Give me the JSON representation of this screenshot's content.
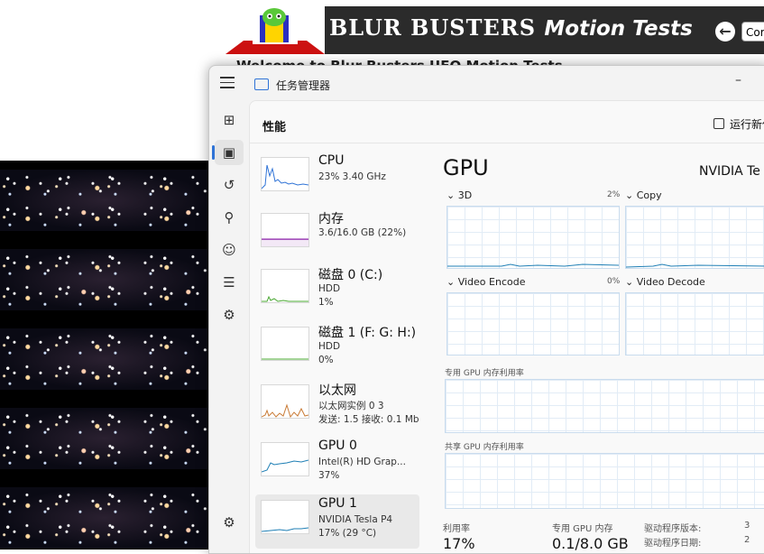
{
  "background_page": {
    "banner_title": "BLUR BUSTERS",
    "banner_subtitle": "Motion Tests",
    "back_icon": "arrow-left-icon",
    "continue_label": "Cor",
    "welcome_text": "Welcome to Blur Busters UFO Motion Tests"
  },
  "task_manager": {
    "window_title": "任务管理器",
    "section_title": "性能",
    "run_task_label": "运行新任",
    "minimize_glyph": "–",
    "nav": [
      {
        "icon": "processes-icon",
        "glyph": "⊞"
      },
      {
        "icon": "performance-icon",
        "glyph": "▣"
      },
      {
        "icon": "app-history-icon",
        "glyph": "↺"
      },
      {
        "icon": "startup-apps-icon",
        "glyph": "⚲"
      },
      {
        "icon": "users-icon",
        "glyph": "☺"
      },
      {
        "icon": "details-icon",
        "glyph": "☰"
      },
      {
        "icon": "services-icon",
        "glyph": "⚙"
      }
    ],
    "settings_glyph": "⚙",
    "devices": [
      {
        "name": "CPU",
        "line1": "23% 3.40 GHz",
        "line2": "",
        "graph_color": "#2f73d6",
        "usage": 0.23
      },
      {
        "name": "内存",
        "line1": "3.6/16.0 GB (22%)",
        "line2": "",
        "graph_color": "#9b3fb5",
        "usage": 0.22
      },
      {
        "name": "磁盘 0 (C:)",
        "line1": "HDD",
        "line2": "1%",
        "graph_color": "#4aa832",
        "usage": 0.01
      },
      {
        "name": "磁盘 1 (F: G: H:)",
        "line1": "HDD",
        "line2": "0%",
        "graph_color": "#4aa832",
        "usage": 0.0
      },
      {
        "name": "以太网",
        "line1": "以太网实例 0 3",
        "line2": "发送: 1.5 接收: 0.1 Mb",
        "graph_color": "#c97b36",
        "usage": 0.05
      },
      {
        "name": "GPU 0",
        "line1": "Intel(R) HD Grap...",
        "line2": "37%",
        "graph_color": "#1f7fb5",
        "usage": 0.37
      },
      {
        "name": "GPU 1",
        "line1": "NVIDIA Tesla P4",
        "line2": "17% (29 °C)",
        "graph_color": "#1f7fb5",
        "usage": 0.17
      }
    ],
    "detail": {
      "title": "GPU",
      "gpu_name": "NVIDIA Te",
      "engines": [
        {
          "label": "3D",
          "pct": "2%"
        },
        {
          "label": "Copy",
          "pct": ""
        },
        {
          "label": "Video Encode",
          "pct": "0%"
        },
        {
          "label": "Video Decode",
          "pct": ""
        }
      ],
      "dedicated_mem_label": "专用 GPU 内存利用率",
      "shared_mem_label": "共享 GPU 内存利用率",
      "stats": {
        "utilization_label": "利用率",
        "utilization_value": "17%",
        "dedicated_label": "专用 GPU 内存",
        "dedicated_value": "0.1/8.0 GB",
        "driver_version_label": "驱动程序版本:",
        "driver_version_value": "3",
        "driver_date_label": "驱动程序日期:",
        "driver_date_value": "2"
      }
    }
  }
}
